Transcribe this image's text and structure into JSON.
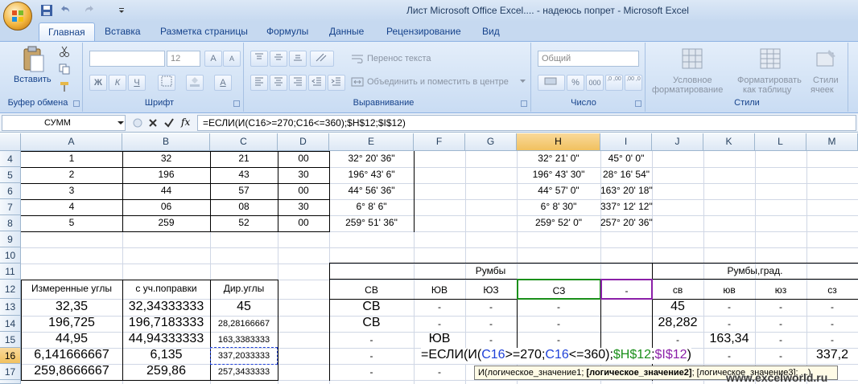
{
  "window": {
    "title": "Лист Microsoft Office Excel.... - надеюсь попрет  -  Microsoft Excel"
  },
  "tabs": [
    "Главная",
    "Вставка",
    "Разметка страницы",
    "Формулы",
    "Данные",
    "Рецензирование",
    "Вид"
  ],
  "ribbon": {
    "paste_label": "Вставить",
    "clipboard_label": "Буфер обмена",
    "font_label": "Шрифт",
    "font_size": "12",
    "align_label": "Выравнивание",
    "wrap_text": "Перенос текста",
    "merge_center": "Объединить и поместить в центре",
    "number_label": "Число",
    "number_format": "Общий",
    "styles_label": "Стили",
    "cond_format_1": "Условное",
    "cond_format_2": "форматирование",
    "format_table_1": "Форматировать",
    "format_table_2": "как таблицу",
    "cell_styles_1": "Стили",
    "cell_styles_2": "ячеек",
    "bold": "Ж",
    "italic": "К",
    "underline": "Ч",
    "grow": "A",
    "shrink": "A",
    "percent": "%",
    "thousands": "000",
    "dec_inc": ",0 ,00",
    "dec_dec": ",00 ,0"
  },
  "formula_bar": {
    "name_box": "СУММ",
    "formula": "=ЕСЛИ(И(C16>=270;C16<=360);$H$12;$I$12)",
    "fx": "fx"
  },
  "columns": [
    "A",
    "B",
    "C",
    "D",
    "E",
    "F",
    "G",
    "H",
    "I",
    "J",
    "K",
    "L",
    "M"
  ],
  "rows": [
    "4",
    "5",
    "6",
    "7",
    "8",
    "9",
    "10",
    "11",
    "12",
    "13",
    "14",
    "15",
    "16",
    "17"
  ],
  "cells": {
    "r4": [
      "1",
      "32",
      "21",
      "00",
      "32° 20' 36\"",
      "32° 21' 0\"",
      "45° 0' 0\""
    ],
    "r5": [
      "2",
      "196",
      "43",
      "30",
      "196° 43' 6\"",
      "196° 43' 30\"",
      "28° 16' 54\""
    ],
    "r6": [
      "3",
      "44",
      "57",
      "00",
      "44° 56' 36\"",
      "44° 57' 0\"",
      "163° 20' 18\""
    ],
    "r7": [
      "4",
      "06",
      "08",
      "30",
      "6° 8' 6\"",
      "6° 8' 30\"",
      "337° 12' 12\""
    ],
    "r8": [
      "5",
      "259",
      "52",
      "00",
      "259° 51' 36\"",
      "259° 52' 0\"",
      "257° 20' 36\""
    ],
    "rumby": "Румбы",
    "rumby_grad": "Румбы,град.",
    "hdr12": [
      "Измеренные углы",
      "с уч.поправки",
      "Дир.углы",
      "СВ",
      "ЮВ",
      "ЮЗ",
      "СЗ",
      "-",
      "св",
      "юв",
      "юз",
      "сз"
    ],
    "r13": [
      "32,35",
      "32,34333333",
      "45",
      "СВ",
      "-",
      "-",
      "-",
      "45",
      "-",
      "-",
      "-"
    ],
    "r14": [
      "196,725",
      "196,7183333",
      "28,28166667",
      "СВ",
      "-",
      "-",
      "-",
      "28,282",
      "-",
      "-",
      "-"
    ],
    "r15": [
      "44,95",
      "44,94333333",
      "163,3383333",
      "-",
      "ЮВ",
      "-",
      "-",
      "-",
      "163,34",
      "-",
      "-"
    ],
    "r16": [
      "6,141666667",
      "6,135",
      "337,2033333",
      "-",
      "-",
      "-",
      "337,2"
    ],
    "r17": [
      "259,8666667",
      "259,86",
      "257,3433333",
      "-",
      "-"
    ],
    "edit_formula_parts": [
      "=ЕСЛИ(И(",
      "C16",
      ">=270;",
      "C16",
      "<=360);",
      "$H$12",
      ";",
      "$I$12",
      ")"
    ],
    "tooltip": "И(логическое_значение1; логическое_значение2]; [логическое_значение3]; ...)",
    "tooltip_parts": [
      "И(логическое_значение1; ",
      "[логическое_значение2]",
      "; [логическое_значение3]; ...)"
    ],
    "watermark": "www.excelworld.ru"
  },
  "colors": {
    "accent": "#15428b",
    "ref_blue": "#2042d8",
    "ref_green": "#1a8f1a",
    "ref_purple": "#8b1fa8"
  }
}
